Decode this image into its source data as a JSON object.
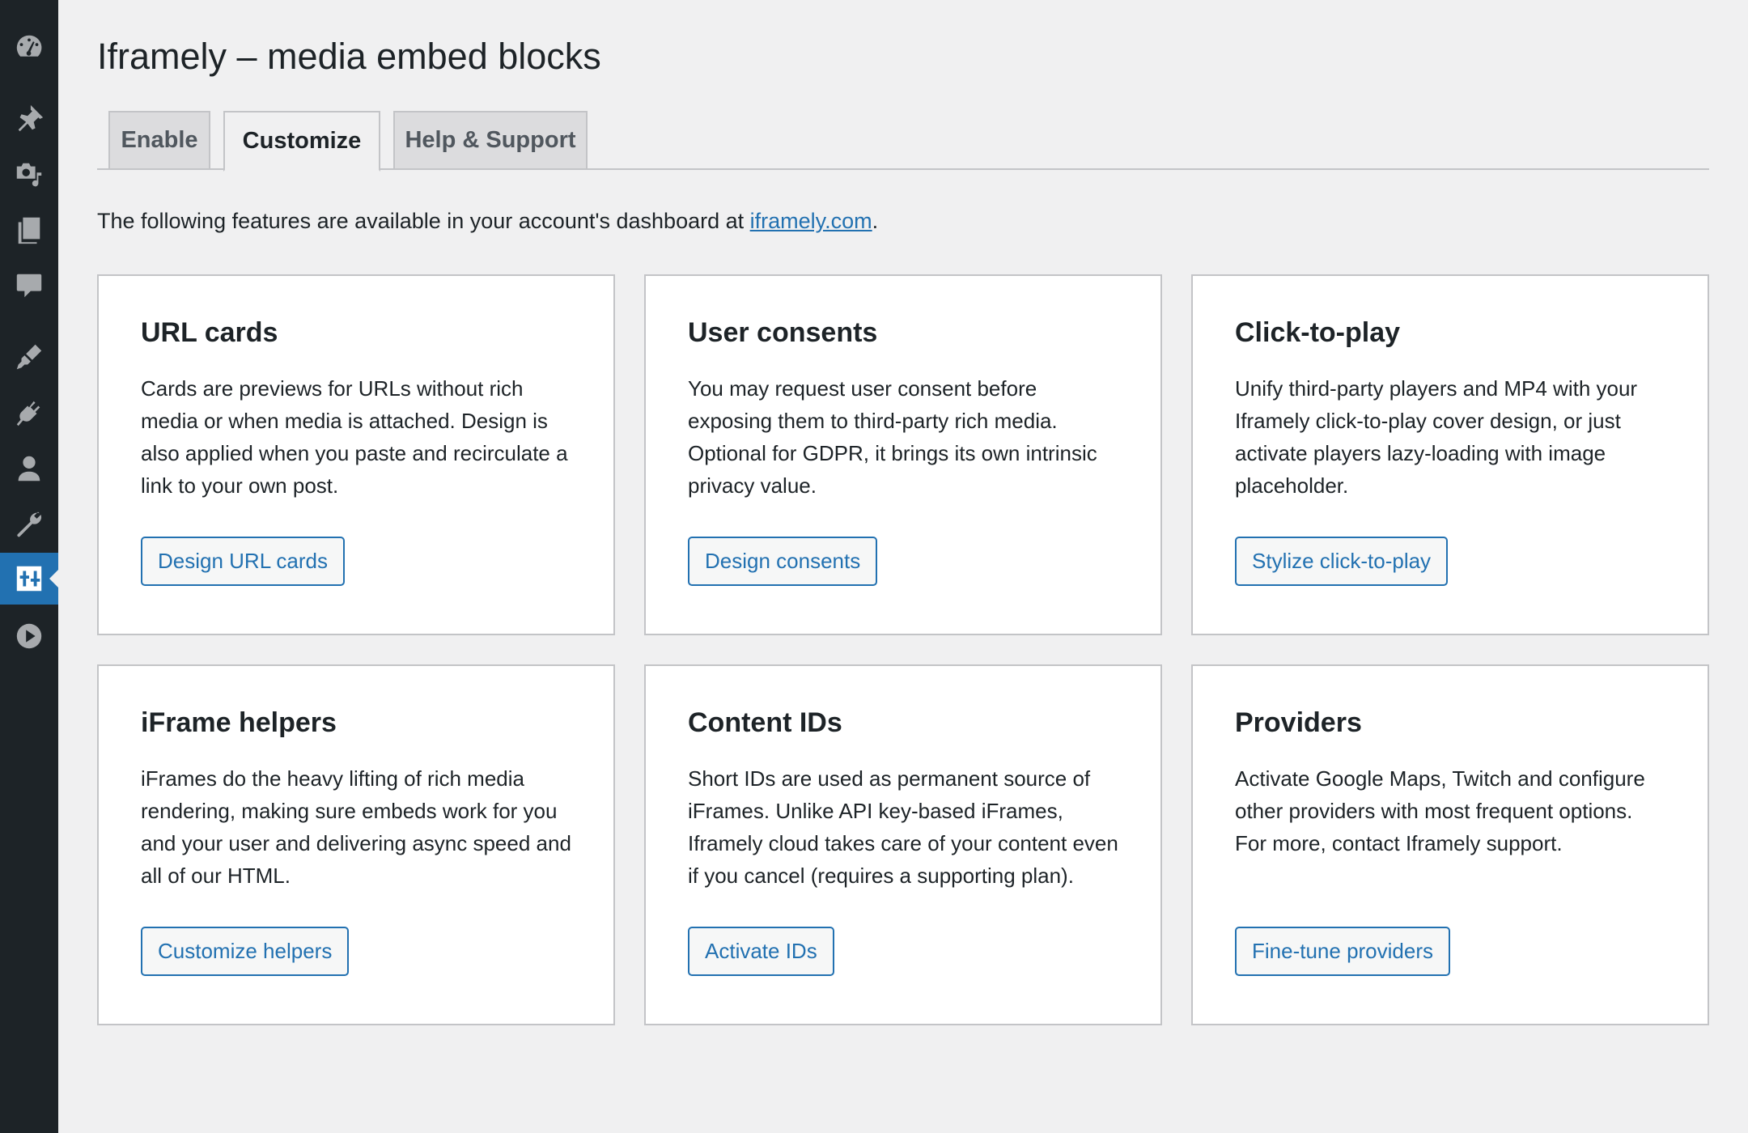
{
  "page": {
    "title": "Iframely – media embed blocks"
  },
  "tabs": [
    {
      "label": "Enable",
      "active": false
    },
    {
      "label": "Customize",
      "active": true
    },
    {
      "label": "Help & Support",
      "active": false
    }
  ],
  "intro": {
    "before": "The following features are available in your account's dashboard at ",
    "link_text": "iframely.com",
    "after": "."
  },
  "cards": [
    {
      "title": "URL cards",
      "description": "Cards are previews for URLs without rich media or when media is attached. Design is also applied when you paste and recirculate a link to your own post.",
      "button": "Design URL cards"
    },
    {
      "title": "User consents",
      "description": "You may request user consent before exposing them to third-party rich media. Optional for GDPR, it brings its own intrinsic privacy value.",
      "button": "Design consents"
    },
    {
      "title": "Click-to-play",
      "description": "Unify third-party players and MP4 with your Iframely click-to-play cover design, or just activate players lazy-loading with image placeholder.",
      "button": "Stylize click-to-play"
    },
    {
      "title": "iFrame helpers",
      "description": "iFrames do the heavy lifting of rich media rendering, making sure embeds work for you and your user and delivering async speed and all of our HTML.",
      "button": "Customize helpers"
    },
    {
      "title": "Content IDs",
      "description": "Short IDs are used as permanent source of iFrames. Unlike API key-based iFrames, Iframely cloud takes care of your content even if you cancel (requires a supporting plan).",
      "button": "Activate IDs"
    },
    {
      "title": "Providers",
      "description": "Activate Google Maps, Twitch and configure other providers with most frequent options. For more, contact Iframely support.",
      "button": "Fine-tune providers"
    }
  ],
  "sidebar": {
    "icons": [
      "dashboard-icon",
      "pin-icon",
      "media-icon",
      "pages-icon",
      "comments-icon",
      "appearance-icon",
      "plugins-icon",
      "users-icon",
      "tools-icon",
      "settings-icon",
      "play-icon"
    ],
    "active_icon": "settings-icon"
  },
  "colors": {
    "accent": "#2271b1",
    "sidebar_bg": "#1d2327",
    "page_bg": "#f0f0f1"
  }
}
